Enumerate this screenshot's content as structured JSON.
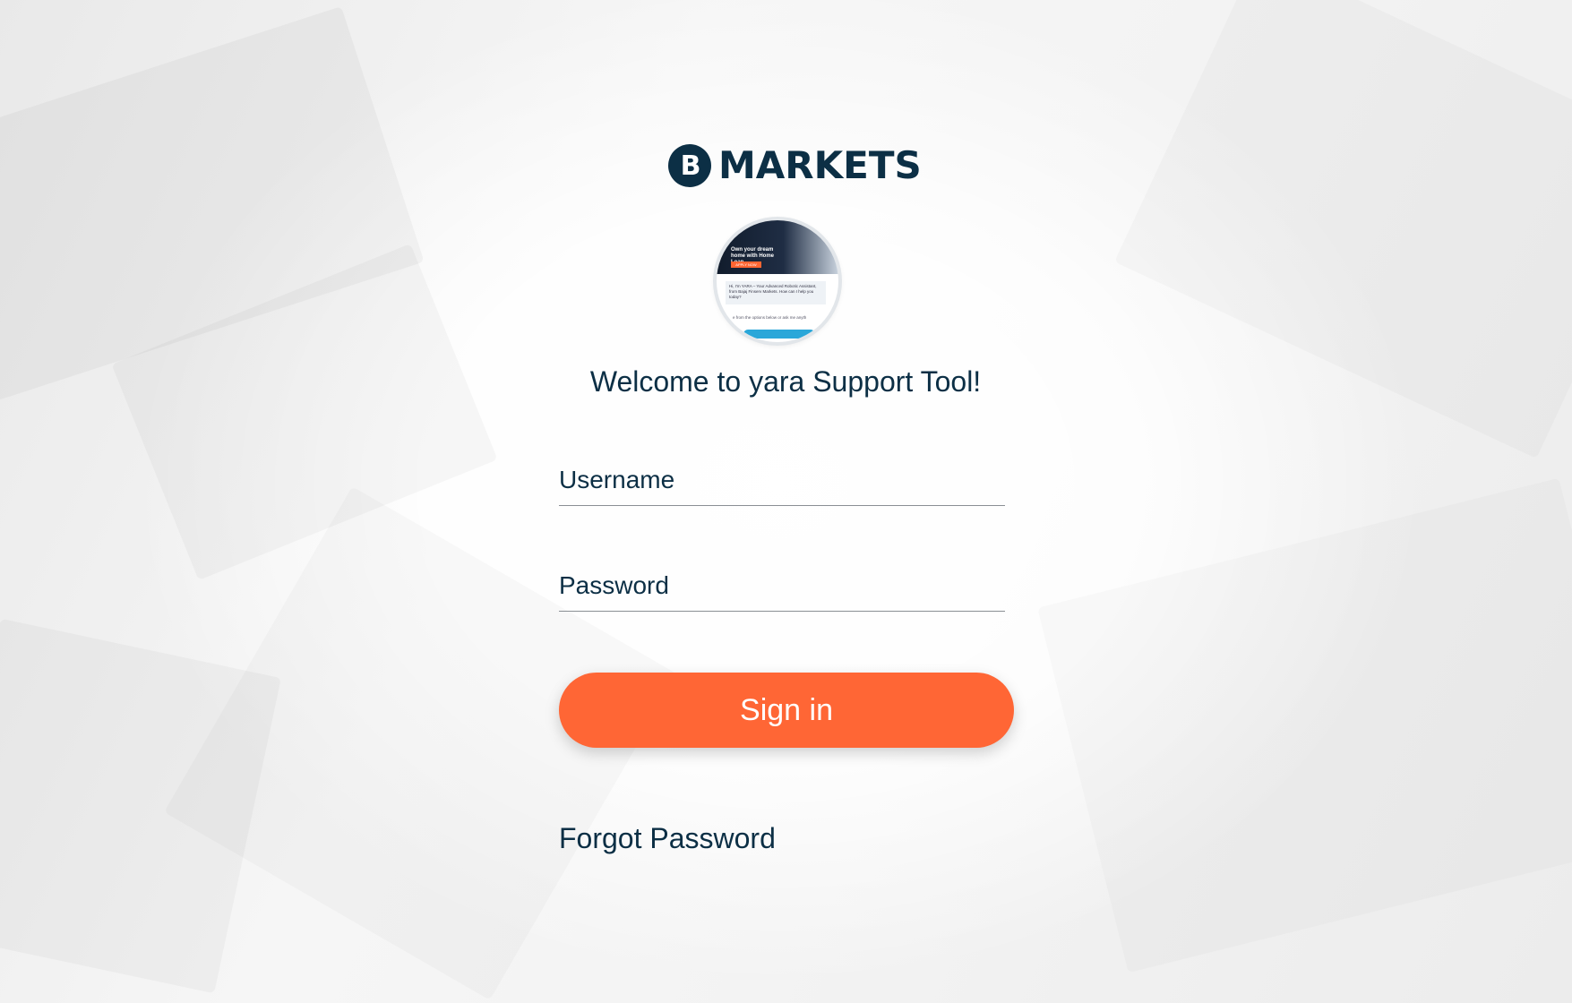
{
  "brand": {
    "logo_mark": "B",
    "logo_text": "MARKETS",
    "color": "#0c2f45"
  },
  "avatar": {
    "banner_text": "Own your dream home with Home Loan",
    "banner_button": "APPLY NOW",
    "chat_text": "Hi, I'm YARA – Your Advanced Robotic Assistant, from Bajaj Finserv Markets. How can I help you today?",
    "options_text": "e from the options below or ask me anyth"
  },
  "welcome_title": "Welcome to yara Support Tool!",
  "form": {
    "username_placeholder": "Username",
    "username_value": "",
    "password_placeholder": "Password",
    "password_value": "",
    "signin_label": "Sign in",
    "forgot_label": "Forgot Password"
  },
  "colors": {
    "accent": "#ff6635",
    "text": "#0c2f45"
  }
}
